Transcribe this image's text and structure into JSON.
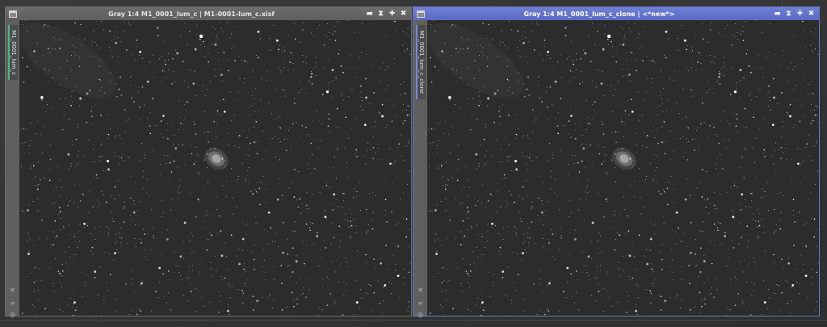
{
  "colors": {
    "accent": "#6a78c8",
    "active_title": "#5a69c2",
    "inactive_title": "#5e5e5e",
    "channel_tab_left": "#3fbf7a",
    "image_background": "#2b2b2b"
  },
  "windows": [
    {
      "title": "Gray 1:4 M1_0001_lum_c | M1-0001-lum_c.xisf",
      "tab_id": "M1_0001_lum_c",
      "active": false,
      "buttons": [
        "▬",
        "⧗",
        "✚",
        "✖"
      ]
    },
    {
      "title": "Gray 1:4 M1_0001_lum_c_clone | <*new*>",
      "tab_id": "M1_0001_lum_c_clone",
      "active": true,
      "buttons": [
        "▬",
        "⧗",
        "✚",
        "✖"
      ]
    }
  ],
  "side_icons": [
    "pin-icon",
    "link-icon",
    "lock-icon"
  ],
  "image": {
    "subject": "crab-nebula-starfield"
  }
}
